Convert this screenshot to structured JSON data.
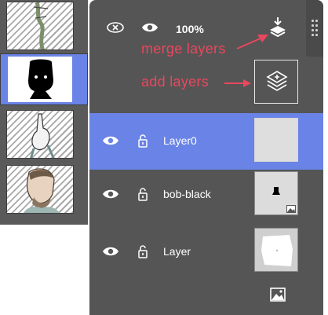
{
  "frames": [
    {
      "name": "frame-1",
      "selected": false
    },
    {
      "name": "frame-2",
      "selected": true
    },
    {
      "name": "frame-3",
      "selected": false
    },
    {
      "name": "frame-4",
      "selected": false
    }
  ],
  "toolbar": {
    "opacity_value": "100%",
    "icons": [
      "hide-all-icon",
      "visibility-icon",
      "merge-layers-icon",
      "panel-grip-icon"
    ]
  },
  "annotations": {
    "merge": "merge layers",
    "add": "add layers",
    "color": "#e8485e"
  },
  "layers": [
    {
      "name": "Layer0",
      "selected": true
    },
    {
      "name": "bob-black",
      "selected": false
    },
    {
      "name": "Layer",
      "selected": false
    }
  ],
  "footer": {
    "icon": "image-icon"
  },
  "colors": {
    "panel": "#555555",
    "selection": "#6a83e6",
    "text": "#ffffff"
  }
}
